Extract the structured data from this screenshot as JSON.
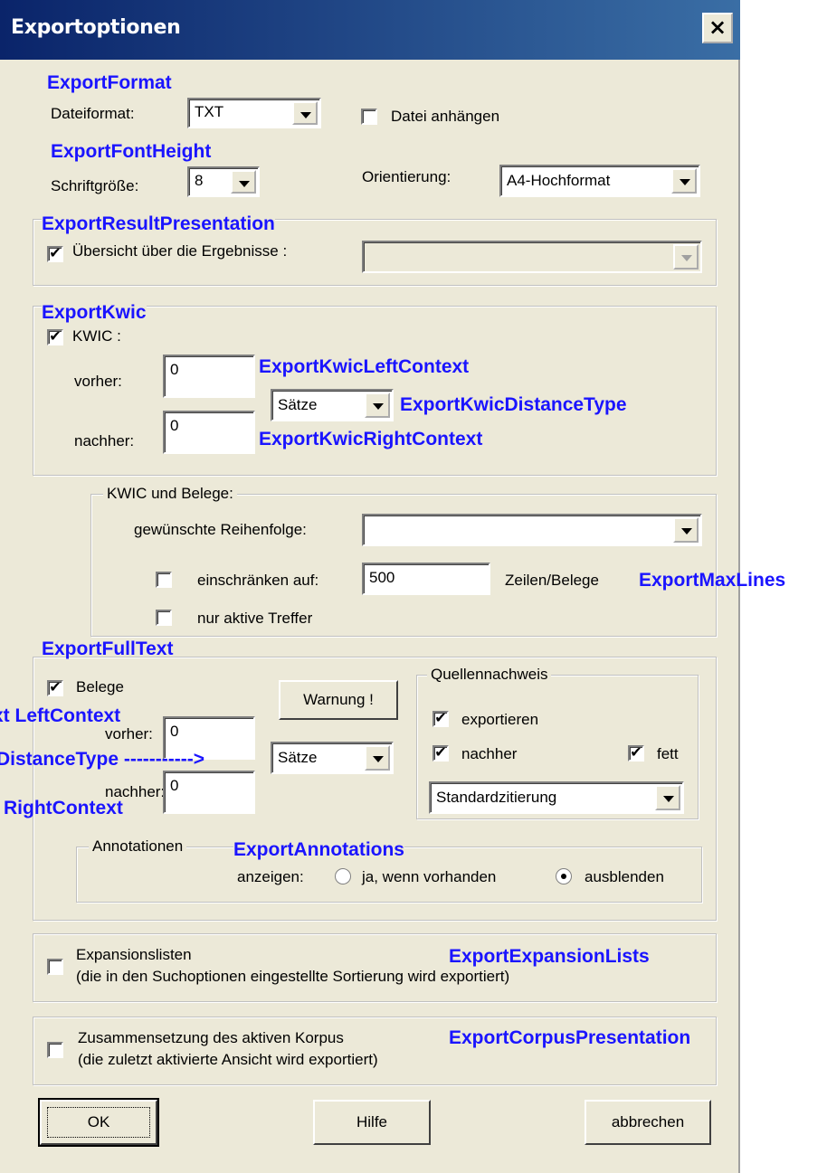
{
  "dialog": {
    "title": "Exportoptionen",
    "close_label": "×"
  },
  "format": {
    "annotation": "ExportFormat",
    "label": "Dateiformat:",
    "value": "TXT",
    "append_label": "Datei anhängen",
    "append_checked": false
  },
  "font": {
    "annotation": "ExportFontHeight",
    "label": "Schriftgröße:",
    "value": "8",
    "orientation_label": "Orientierung:",
    "orientation_value": "A4-Hochformat"
  },
  "results": {
    "annotation": "ExportResultPresentation",
    "label": "Übersicht über die Ergebnisse :",
    "checked": true,
    "value": ""
  },
  "kwic": {
    "annotation": "ExportKwic",
    "label": "KWIC :",
    "checked": true,
    "before_label": "vorher:",
    "before_value": "0",
    "after_label": "nachher:",
    "after_value": "0",
    "distance_value": "Sätze",
    "left_context_annotation": "ExportKwicLeftContext",
    "distance_annotation": "ExportKwicDistanceType",
    "right_context_annotation": "ExportKwicRightContext"
  },
  "kwic_belege": {
    "title": "KWIC und Belege:",
    "order_label": "gewünschte Reihenfolge:",
    "order_value": "",
    "limit_label": "einschränken auf:",
    "limit_value": "500",
    "limit_unit": "Zeilen/Belege",
    "limit_checked": false,
    "active_label": "nur aktive Treffer",
    "active_checked": false,
    "max_lines_annotation": "ExportMaxLines"
  },
  "fulltext": {
    "annotation": "ExportFullText",
    "label": "Belege",
    "checked": true,
    "warning_label": "Warnung !",
    "before_label": "vorher:",
    "before_value": "0",
    "after_label": "nachher:",
    "after_value": "0",
    "distance_value": "Sätze",
    "left_context_annotation": "xt LeftContext",
    "distance_annotation": "DistanceType ----------->",
    "right_context_annotation": "RightContext"
  },
  "source": {
    "title": "Quellennachweis",
    "export_label": "exportieren",
    "export_checked": true,
    "after_label": "nachher",
    "after_checked": true,
    "bold_label": "fett",
    "bold_checked": true,
    "citation_value": "Standardzitierung"
  },
  "annotations": {
    "title": "Annotationen",
    "annotation": "ExportAnnotations",
    "show_label": "anzeigen:",
    "option_yes": "ja, wenn vorhanden",
    "option_hide": "ausblenden",
    "selected": "ausblenden"
  },
  "expansion": {
    "annotation": "ExportExpansionLists",
    "line1": "Expansionslisten",
    "line2": "(die in den Suchoptionen eingestellte Sortierung wird exportiert)",
    "checked": false
  },
  "corpus": {
    "annotation": "ExportCorpusPresentation",
    "line1": "Zusammensetzung des aktiven Korpus",
    "line2": "(die zuletzt aktivierte Ansicht wird exportiert)",
    "checked": false
  },
  "buttons": {
    "ok": "OK",
    "help": "Hilfe",
    "cancel": "abbrechen"
  },
  "icons": {
    "check": "✔",
    "close": "close-icon",
    "dropdown": "chevron-down-icon"
  }
}
